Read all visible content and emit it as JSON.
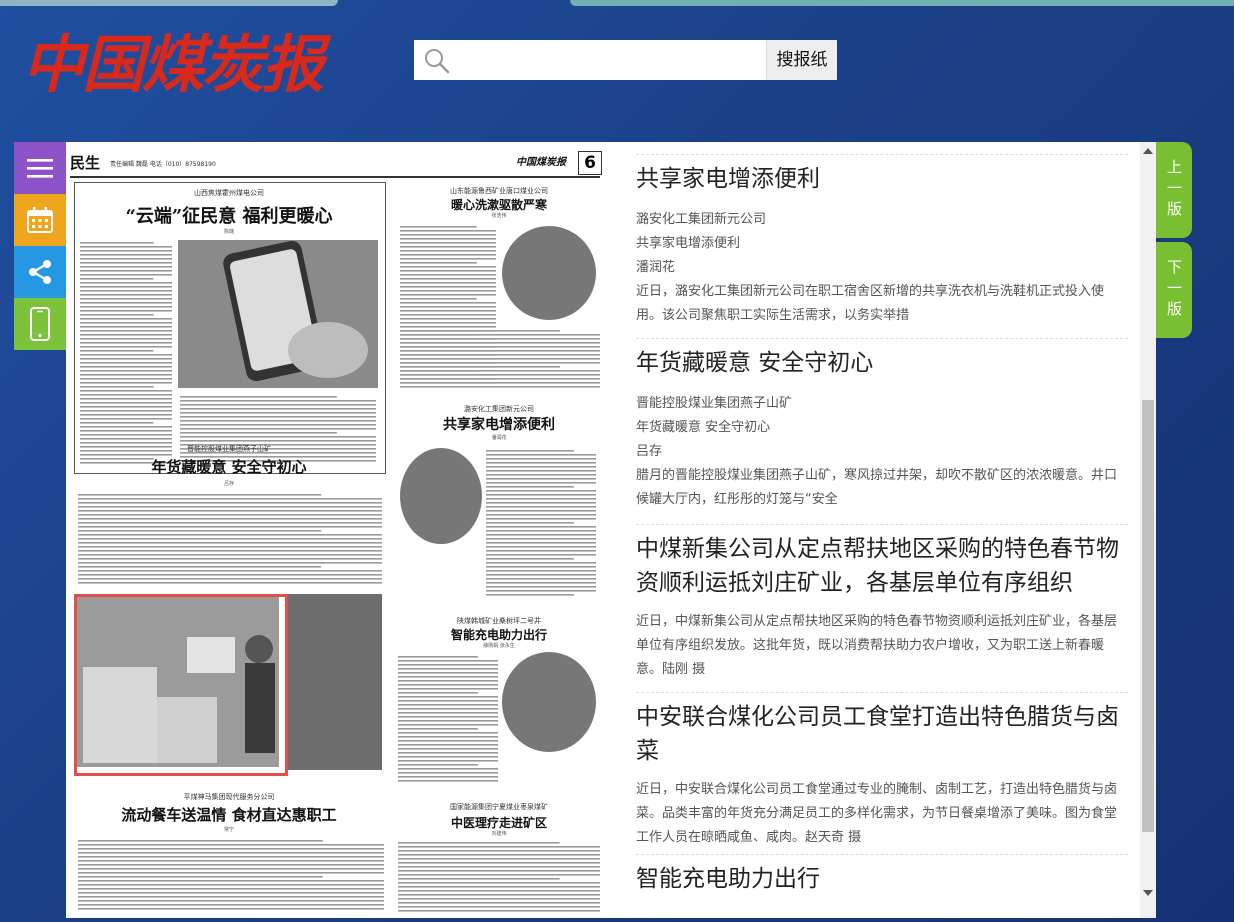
{
  "logo": {
    "text": "中国煤炭报"
  },
  "search": {
    "placeholder": "",
    "button_label": "搜报纸"
  },
  "toolbar": {
    "icons": [
      "menu-icon",
      "calendar-icon",
      "share-icon",
      "mobile-icon"
    ]
  },
  "colors": {
    "background": "#1c3f86",
    "logo_red": "#d8291d",
    "page_button": "#78bf31",
    "menu": "#8e53c9",
    "calendar": "#f0a51f",
    "share": "#2597e3",
    "mobile": "#7cc23b"
  },
  "nav": {
    "prev_label": "上一版",
    "next_label": "下一版"
  },
  "paper": {
    "section": "民生",
    "editor_line": "责任编辑 魏磊  电话（010）87598190",
    "masthead": "中国煤炭报",
    "page_number": "6",
    "articles": [
      {
        "kicker": "山西焦煤霍州煤电公司",
        "title": "“云端”征民意  福利更暖心",
        "byline": "陈璐"
      },
      {
        "kicker": "山东能源鲁西矿业唐口煤业公司",
        "title": "暖心洗漱驱散严寒",
        "byline": "张浩伟"
      },
      {
        "kicker": "晋能控股煤业集团燕子山矿",
        "title": "年货藏暖意  安全守初心",
        "byline": "吕存"
      },
      {
        "kicker": "潞安化工集团新元公司",
        "title": "共享家电增添便利",
        "byline": "潘润花"
      },
      {
        "kicker": "陕煤韩城矿业桑树坪二号井",
        "title": "智能充电助力出行",
        "byline": "薛刚娟  张永生"
      },
      {
        "kicker": "平煤神马集团现代服务分公司",
        "title": "流动餐车送温情  食材直达惠职工",
        "byline": "常宁"
      },
      {
        "kicker": "国家能源集团宁夏煤业枣泉煤矿",
        "title": "中医理疗走进矿区",
        "byline": "刘建伟"
      }
    ]
  },
  "list": {
    "items": [
      {
        "title": "共享家电增添便利",
        "unit": "潞安化工集团新元公司",
        "subtitle": "共享家电增添便利",
        "author": "潘润花",
        "abstract": "近日，潞安化工集团新元公司在职工宿舍区新增的共享洗衣机与洗鞋机正式投入使用。该公司聚焦职工实际生活需求，以务实举措"
      },
      {
        "title": "年货藏暖意 安全守初心",
        "unit": "晋能控股煤业集团燕子山矿",
        "subtitle": "年货藏暖意 安全守初心",
        "author": "吕存",
        "abstract": "腊月的晋能控股煤业集团燕子山矿，寒风掠过井架，却吹不散矿区的浓浓暖意。井口候罐大厅内，红彤彤的灯笼与“安全"
      },
      {
        "title": "中煤新集公司从定点帮扶地区采购的特色春节物资顺利运抵刘庄矿业，各基层单位有序组织",
        "abstract": "近日，中煤新集公司从定点帮扶地区采购的特色春节物资顺利运抵刘庄矿业，各基层单位有序组织发放。这批年货，既以消费帮扶助力农户增收，又为职工送上新春暖意。陆刚 摄"
      },
      {
        "title": "中安联合煤化公司员工食堂打造出特色腊货与卤菜",
        "abstract": "近日，中安联合煤化公司员工食堂通过专业的腌制、卤制工艺，打造出特色腊货与卤菜。品类丰富的年货充分满足员工的多样化需求，为节日餐桌增添了美味。图为食堂工作人员在晾晒咸鱼、咸肉。赵天奇 摄"
      },
      {
        "title": "智能充电助力出行"
      }
    ]
  }
}
